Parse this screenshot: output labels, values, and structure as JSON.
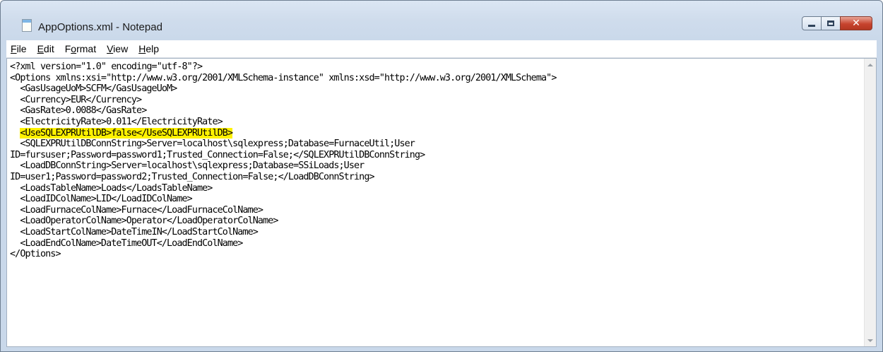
{
  "window": {
    "title": "AppOptions.xml - Notepad"
  },
  "menu": {
    "file": {
      "mnemonic": "F",
      "rest": "ile"
    },
    "edit": {
      "mnemonic": "E",
      "rest": "dit"
    },
    "format": {
      "pre": "F",
      "mnemonic": "o",
      "rest": "rmat"
    },
    "view": {
      "mnemonic": "V",
      "rest": "iew"
    },
    "help": {
      "mnemonic": "H",
      "rest": "elp"
    }
  },
  "editor": {
    "lines": [
      "<?xml version=\"1.0\" encoding=\"utf-8\"?>",
      "<Options xmlns:xsi=\"http://www.w3.org/2001/XMLSchema-instance\" xmlns:xsd=\"http://www.w3.org/2001/XMLSchema\">",
      "  <GasUsageUoM>SCFM</GasUsageUoM>",
      "  <Currency>EUR</Currency>",
      "  <GasRate>0.0088</GasRate>",
      "  <ElectricityRate>0.011</ElectricityRate>",
      "  <SQLEXPRUtilDBConnString>Server=localhost\\sqlexpress;Database=FurnaceUtil;User",
      "ID=fursuser;Password=password1;Trusted_Connection=False;</SQLEXPRUtilDBConnString>",
      "  <LoadDBConnString>Server=localhost\\sqlexpress;Database=SSiLoads;User",
      "ID=user1;Password=password2;Trusted_Connection=False;</LoadDBConnString>",
      "  <LoadsTableName>Loads</LoadsTableName>",
      "  <LoadIDColName>LID</LoadIDColName>",
      "  <LoadFurnaceColName>Furnace</LoadFurnaceColName>",
      "  <LoadOperatorColName>Operator</LoadOperatorColName>",
      "  <LoadStartColName>DateTimeIN</LoadStartColName>",
      "  <LoadEndColName>DateTimeOUT</LoadEndColName>",
      "</Options>"
    ],
    "highlighted_line": {
      "indent": "  ",
      "text": "<UseSQLEXPRUtilDB>false</UseSQLEXPRUtilDB>"
    },
    "highlight_color": "#fff200"
  }
}
